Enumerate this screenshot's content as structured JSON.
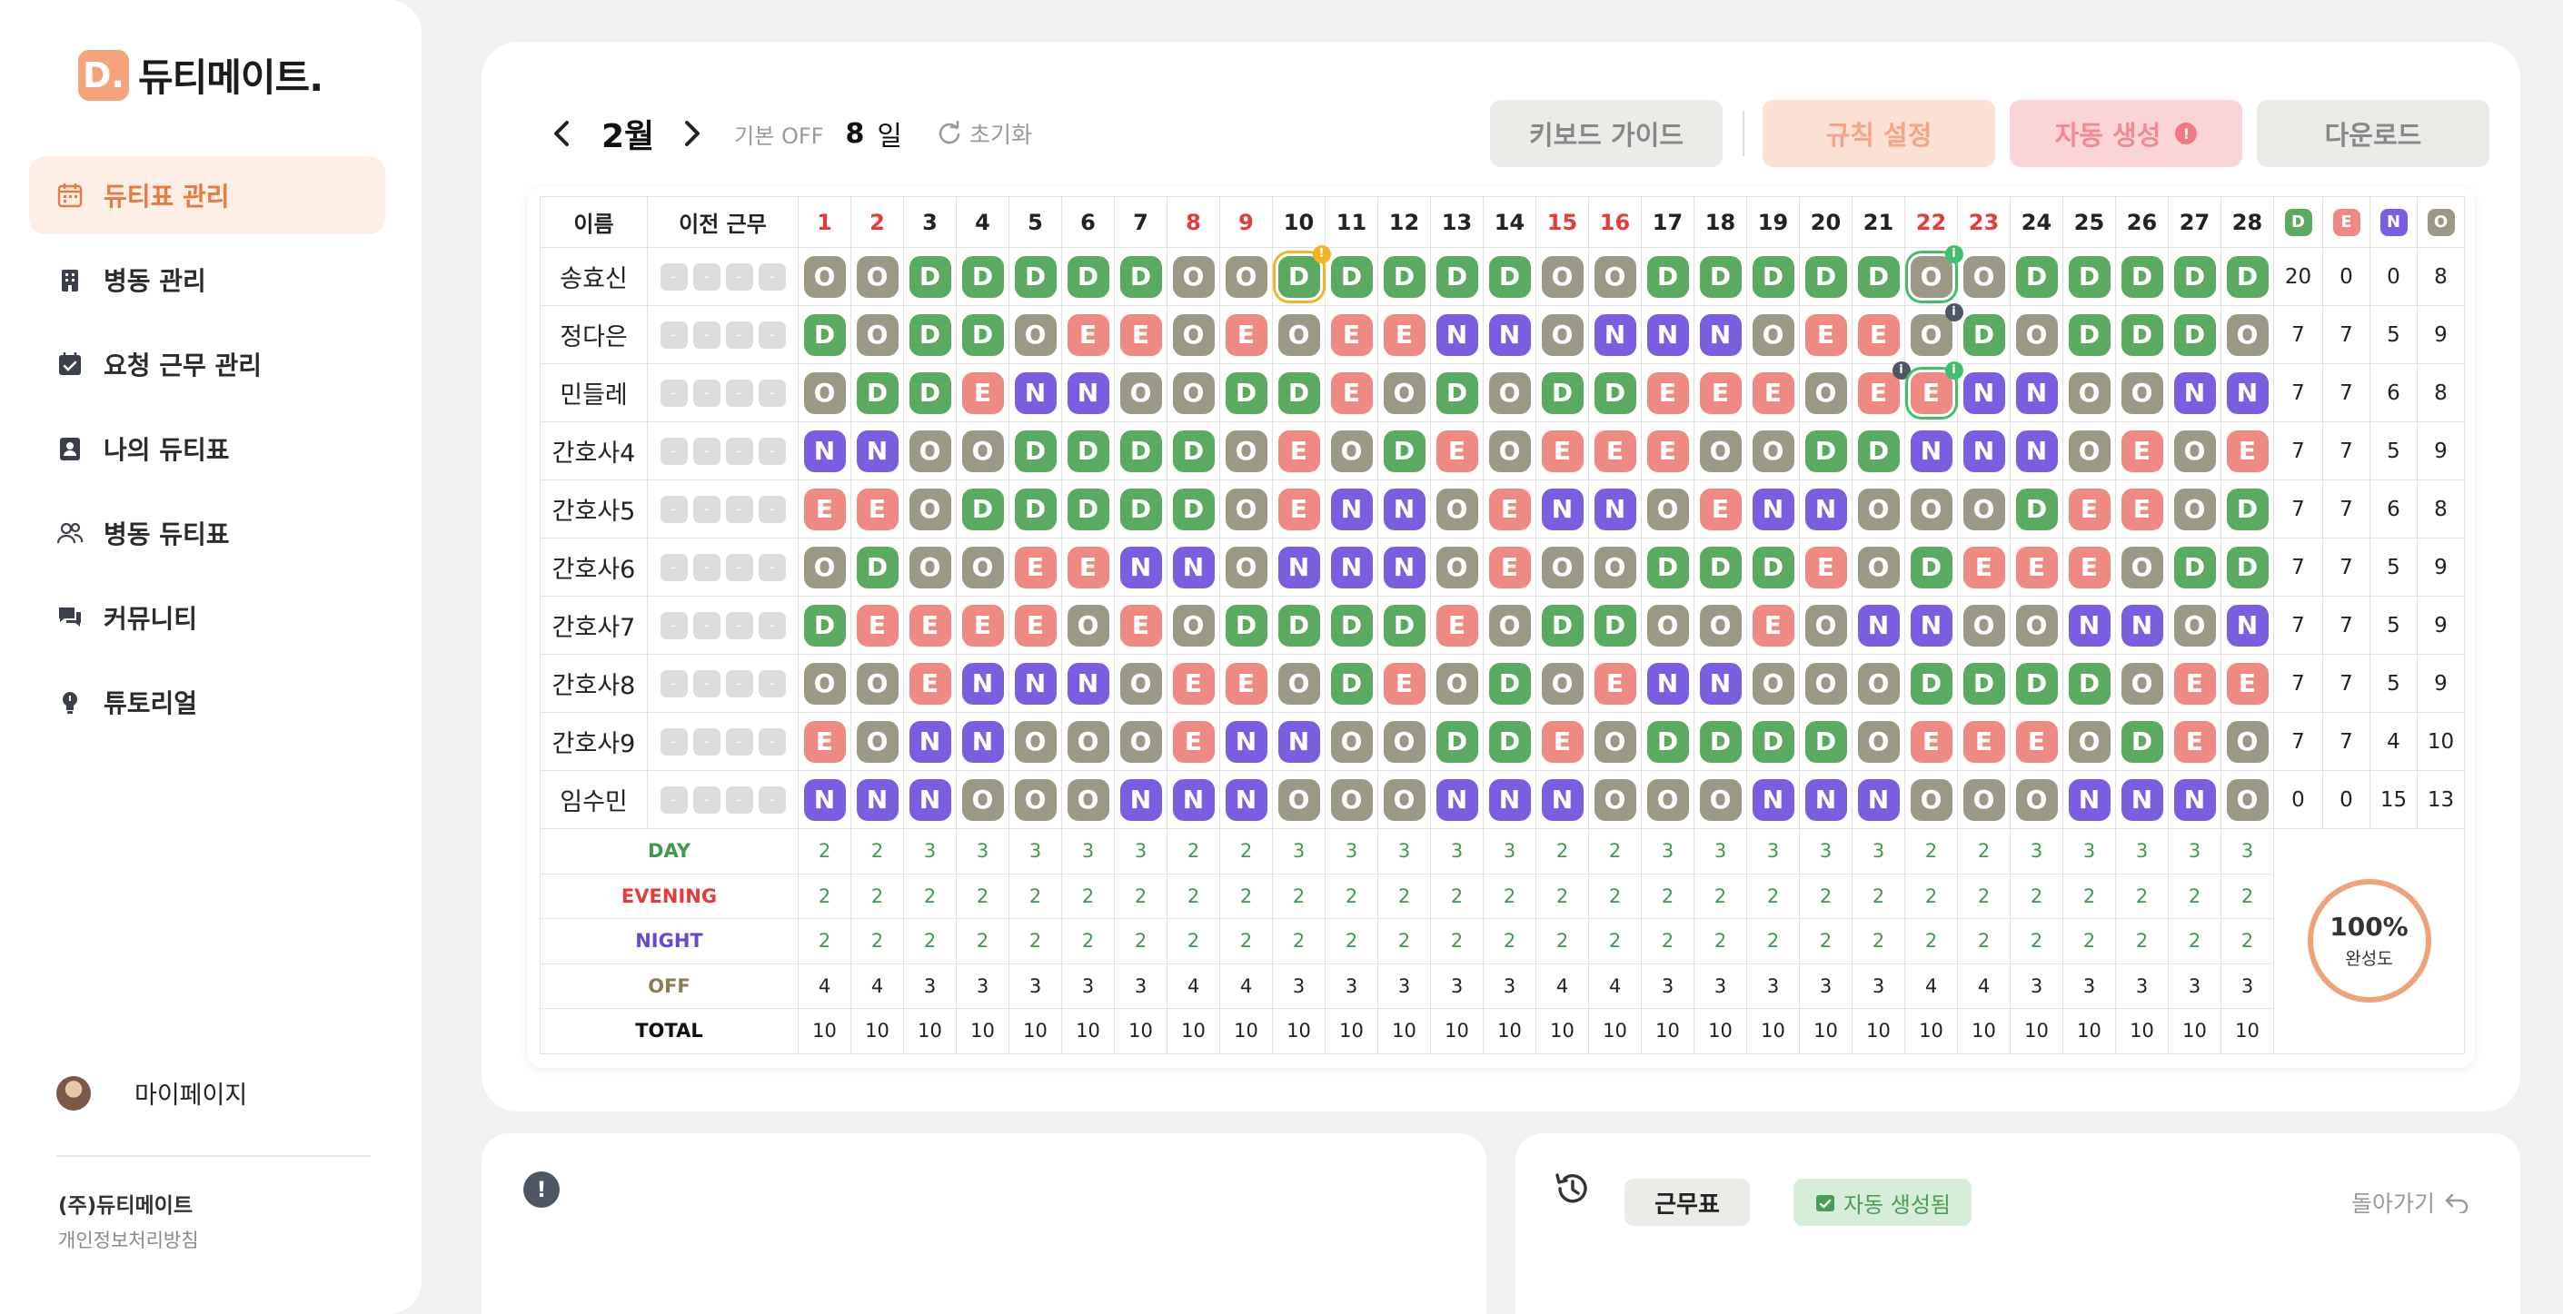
{
  "brand": {
    "logo_letter": "D.",
    "name": "듀티메이트."
  },
  "sidebar": {
    "items": [
      {
        "label": "듀티표 관리",
        "icon": "calendar-icon",
        "active": true
      },
      {
        "label": "병동 관리",
        "icon": "building-icon"
      },
      {
        "label": "요청 근무 관리",
        "icon": "calendar-check-icon"
      },
      {
        "label": "나의 듀티표",
        "icon": "id-card-icon"
      },
      {
        "label": "병동 듀티표",
        "icon": "users-icon"
      },
      {
        "label": "커뮤니티",
        "icon": "chat-icon"
      },
      {
        "label": "튜토리얼",
        "icon": "lightbulb-icon"
      }
    ],
    "mypage": "마이페이지",
    "company": "(주)듀티메이트",
    "privacy": "개인정보처리방침"
  },
  "toolbar": {
    "month": "2월",
    "base_off_label": "기본 OFF",
    "base_off_value": "8",
    "base_off_unit": "일",
    "reset": "초기화",
    "keyboard_guide": "키보드 가이드",
    "rule_settings": "규칙 설정",
    "auto_generate": "자동 생성",
    "auto_generate_badge": "!",
    "download": "다운로드"
  },
  "table": {
    "header_name": "이름",
    "header_prev": "이전 근무",
    "days": [
      "1",
      "2",
      "3",
      "4",
      "5",
      "6",
      "7",
      "8",
      "9",
      "10",
      "11",
      "12",
      "13",
      "14",
      "15",
      "16",
      "17",
      "18",
      "19",
      "20",
      "21",
      "22",
      "23",
      "24",
      "25",
      "26",
      "27",
      "28"
    ],
    "red_days": [
      "1",
      "2",
      "8",
      "9",
      "15",
      "16",
      "22",
      "23"
    ],
    "summary_headers": [
      {
        "label": "D",
        "color": "#5aaa62"
      },
      {
        "label": "E",
        "color": "#ef8a82"
      },
      {
        "label": "N",
        "color": "#7b5de0"
      },
      {
        "label": "O",
        "color": "#9c9886"
      }
    ],
    "prev_placeholder": "-",
    "nurses": [
      {
        "name": "송효신",
        "shifts": "OODDDDDOODDDDDOODDDDDOODDDDD",
        "sums": [
          "20",
          "0",
          "0",
          "8"
        ]
      },
      {
        "name": "정다은",
        "shifts": "DODDOEEOEOEENNONNNOEEODODDDO",
        "sums": [
          "7",
          "7",
          "5",
          "9"
        ]
      },
      {
        "name": "민들레",
        "shifts": "ODDENNOODDEODODDEEEOEENNOONN",
        "sums": [
          "7",
          "7",
          "6",
          "8"
        ]
      },
      {
        "name": "간호사4",
        "shifts": "NNOODDDDOEODEOEEEOODDNNNOEOE",
        "sums": [
          "7",
          "7",
          "5",
          "9"
        ]
      },
      {
        "name": "간호사5",
        "shifts": "EEODDDDDOENNOENNOENNOOODEEOD",
        "sums": [
          "7",
          "7",
          "6",
          "8"
        ]
      },
      {
        "name": "간호사6",
        "shifts": "ODOOEENNONNNOEOODDDEODEEEODD",
        "sums": [
          "7",
          "7",
          "5",
          "9"
        ]
      },
      {
        "name": "간호사7",
        "shifts": "DEEEEOEODDDDEODDOOEONNOONNON",
        "sums": [
          "7",
          "7",
          "5",
          "9"
        ]
      },
      {
        "name": "간호사8",
        "shifts": "OOENNNOEEODEODOENNOOODDDDOEE",
        "sums": [
          "7",
          "7",
          "5",
          "9"
        ]
      },
      {
        "name": "간호사9",
        "shifts": "EONNOOOENNOODDEODDDDOEEEODEO",
        "sums": [
          "7",
          "7",
          "4",
          "10"
        ]
      },
      {
        "name": "임수민",
        "shifts": "NNNOOONNNOOONNNOOONNNOOONNNO",
        "sums": [
          "0",
          "0",
          "15",
          "13"
        ]
      }
    ],
    "stats": [
      {
        "label": "DAY",
        "values": [
          "2",
          "2",
          "3",
          "3",
          "3",
          "3",
          "3",
          "2",
          "2",
          "3",
          "3",
          "3",
          "3",
          "3",
          "2",
          "2",
          "3",
          "3",
          "3",
          "3",
          "3",
          "2",
          "2",
          "3",
          "3",
          "3",
          "3",
          "3"
        ]
      },
      {
        "label": "EVENING",
        "values": [
          "2",
          "2",
          "2",
          "2",
          "2",
          "2",
          "2",
          "2",
          "2",
          "2",
          "2",
          "2",
          "2",
          "2",
          "2",
          "2",
          "2",
          "2",
          "2",
          "2",
          "2",
          "2",
          "2",
          "2",
          "2",
          "2",
          "2",
          "2"
        ]
      },
      {
        "label": "NIGHT",
        "values": [
          "2",
          "2",
          "2",
          "2",
          "2",
          "2",
          "2",
          "2",
          "2",
          "2",
          "2",
          "2",
          "2",
          "2",
          "2",
          "2",
          "2",
          "2",
          "2",
          "2",
          "2",
          "2",
          "2",
          "2",
          "2",
          "2",
          "2",
          "2"
        ]
      },
      {
        "label": "OFF",
        "values": [
          "4",
          "4",
          "3",
          "3",
          "3",
          "3",
          "3",
          "4",
          "4",
          "3",
          "3",
          "3",
          "3",
          "3",
          "4",
          "4",
          "3",
          "3",
          "3",
          "3",
          "3",
          "4",
          "4",
          "3",
          "3",
          "3",
          "3",
          "3"
        ]
      },
      {
        "label": "TOTAL",
        "values": [
          "10",
          "10",
          "10",
          "10",
          "10",
          "10",
          "10",
          "10",
          "10",
          "10",
          "10",
          "10",
          "10",
          "10",
          "10",
          "10",
          "10",
          "10",
          "10",
          "10",
          "10",
          "10",
          "10",
          "10",
          "10",
          "10",
          "10",
          "10"
        ]
      }
    ],
    "completion": {
      "value": "100%",
      "label": "완성도"
    },
    "highlights": [
      {
        "row": 0,
        "day": 10,
        "style": "yellow",
        "badge": "!"
      },
      {
        "row": 0,
        "day": 22,
        "style": "green",
        "badge": "i"
      },
      {
        "row": 2,
        "day": 22,
        "style": "green",
        "badge": "i"
      }
    ]
  },
  "bottom": {
    "info_icon": "!",
    "tab_schedule": "근무표",
    "tab_auto": "자동 생성됨",
    "back": "돌아가기"
  }
}
